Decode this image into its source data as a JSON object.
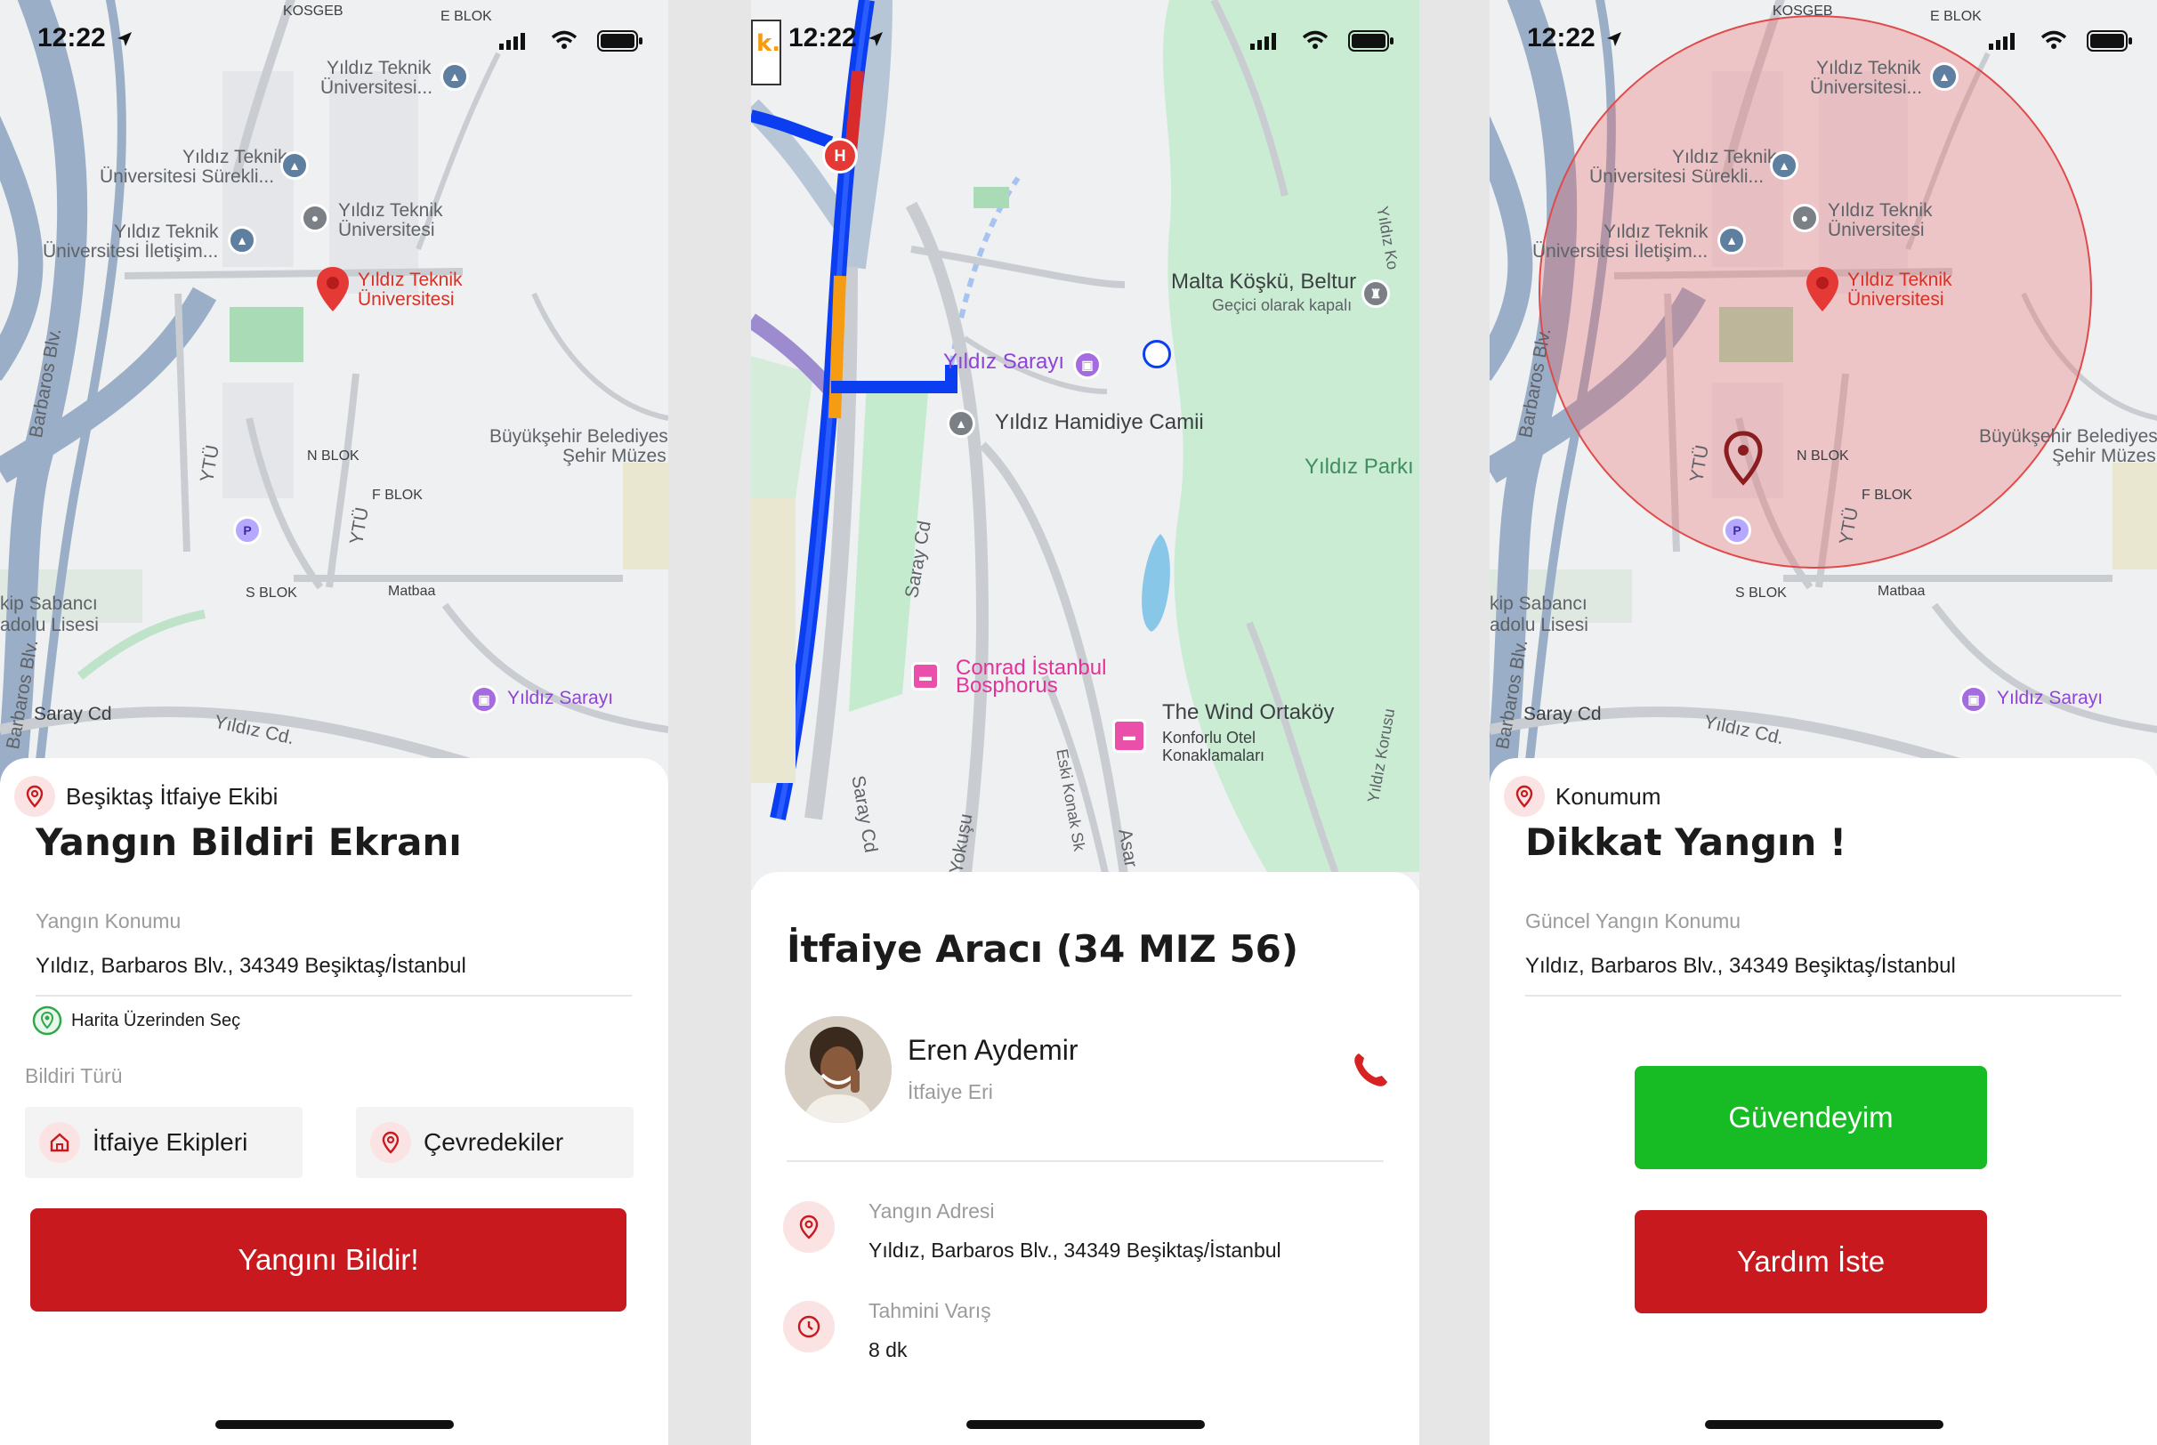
{
  "status_bar": {
    "time": "12:22"
  },
  "screen1": {
    "map_labels": {
      "kosgeb": "KOSGEB",
      "e_blok": "E BLOK",
      "ytu_1": "Yıldız Teknik",
      "ytu_1b": "Üniversitesi...",
      "ytu_2": "Yıldız Teknik",
      "ytu_2b": "Üniversitesi Sürekli...",
      "ytu_3": "Yıldız Teknik",
      "ytu_3b": "Üniversitesi",
      "ytu_4": "Yıldız Teknik",
      "ytu_4b": "Üniversitesi İletişim...",
      "pin_1": "Yıldız Teknik",
      "pin_1b": "Üniversitesi",
      "bb_1": "Büyükşehir Belediyes",
      "bb_2": "Şehir Müzes",
      "n_blok": "N BLOK",
      "f_blok": "F BLOK",
      "s_blok": "S BLOK",
      "matbaa": "Matbaa",
      "barbaros": "Barbaros Blv.",
      "barbaros2": "Barbaros Blv.",
      "ytu_road": "YTÜ",
      "ytu_road2": "YTÜ",
      "sabanci_1": "kip Sabancı",
      "sabanci_2": "adolu Lisesi",
      "saray_cd": "Saray Cd",
      "yildiz_cd": "Yıldız Cd.",
      "yildiz_sarayi": "Yıldız Sarayı",
      "parking": "P"
    },
    "header_location": "Beşiktaş İtfaiye Ekibi",
    "title": "Yangın Bildiri Ekranı",
    "location_label": "Yangın Konumu",
    "location_value": "Yıldız, Barbaros Blv., 34349 Beşiktaş/İstanbul",
    "map_select": "Harita Üzerinden Seç",
    "type_label": "Bildiri Türü",
    "type_1": "İtfaiye Ekipleri",
    "type_2": "Çevredekiler",
    "submit": "Yangını Bildir!"
  },
  "screen2": {
    "map_labels": {
      "k": "k.",
      "malta_1": "Malta Köşkü, Beltur",
      "malta_2": "Geçici olarak kapalı",
      "yildiz_sarayi": "Yıldız Sarayı",
      "hamidiye": "Yıldız Hamidiye Camii",
      "yildiz_parki": "Yıldız Parkı",
      "conrad_1": "Conrad İstanbul",
      "conrad_2": "Bosphorus",
      "wind_1": "The Wind Ortaköy",
      "wind_2": "Konforlu Otel",
      "wind_3": "Konaklamaları",
      "saray_cd": "Saray Cd",
      "saray_cd2": "Saray Cd",
      "yokusu": "Yokuşu",
      "eski_konak": "Eski Konak Sk",
      "asar": "Asar",
      "yildiz_korusu": "Yıldız Korusu",
      "yildiz_ko": "Yıldız Ko",
      "hospital": "H"
    },
    "vehicle_title": "İtfaiye Aracı (34 MIZ 56)",
    "driver_name": "Eren Aydemir",
    "driver_role": "İtfaiye Eri",
    "address_label": "Yangın Adresi",
    "address_value": "Yıldız, Barbaros Blv., 34349 Beşiktaş/İstanbul",
    "eta_label": "Tahmini Varış",
    "eta_value": "8 dk"
  },
  "screen3": {
    "header_location": "Konumum",
    "title": "Dikkat Yangın !",
    "location_label": "Güncel Yangın Konumu",
    "location_value": "Yıldız, Barbaros Blv., 34349 Beşiktaş/İstanbul",
    "safe_button": "Güvendeyim",
    "help_button": "Yardım İste"
  },
  "colors": {
    "primary_red": "#c8191e",
    "safe_green": "#17bb24",
    "route_blue": "#0a3ef0",
    "route_orange": "#f59c12",
    "danger_zone": "#f25555"
  }
}
